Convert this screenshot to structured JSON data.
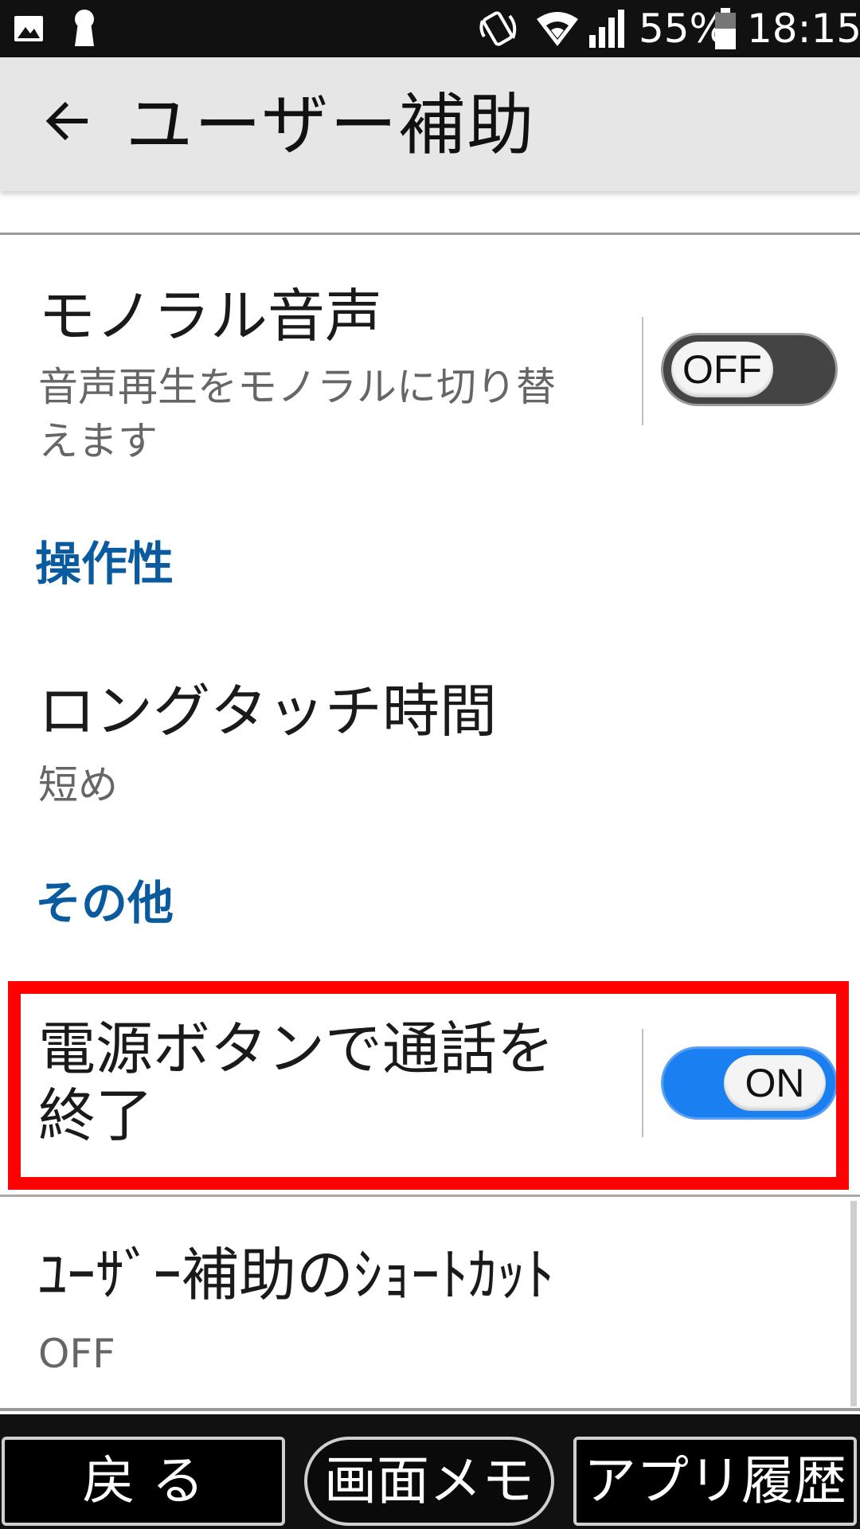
{
  "status_bar": {
    "battery_percent": "55%",
    "time": "18:15",
    "icons": [
      "image-icon",
      "keyhole-icon",
      "nfc-icon",
      "wifi-icon",
      "signal-icon",
      "battery-icon"
    ]
  },
  "header": {
    "title": "ユーザー補助",
    "back_icon": "arrow-left-icon"
  },
  "items": {
    "mono_audio": {
      "title": "モノラル音声",
      "summary_line1": "音声再生をモノラルに切り替",
      "summary_line2": "えます",
      "toggle_label": "OFF",
      "state": "off"
    },
    "section_operability": "操作性",
    "long_touch": {
      "title": "ロングタッチ時間",
      "summary": "短め"
    },
    "section_other": "その他",
    "power_end_call": {
      "title_line1": "電源ボタンで通話を",
      "title_line2": "終了",
      "toggle_label": "ON",
      "state": "on"
    },
    "shortcut": {
      "title": "ﾕｰｻﾞｰ補助のｼｮｰﾄｶｯﾄ",
      "summary": "OFF"
    }
  },
  "bottom_nav": {
    "back": "戻 る",
    "screen_memo": "画面メモ",
    "app_history": "アプリ履歴"
  },
  "colors": {
    "accent_header": "#0a5aa0",
    "toggle_on": "#1a7ff0",
    "highlight": "#ff0000"
  }
}
